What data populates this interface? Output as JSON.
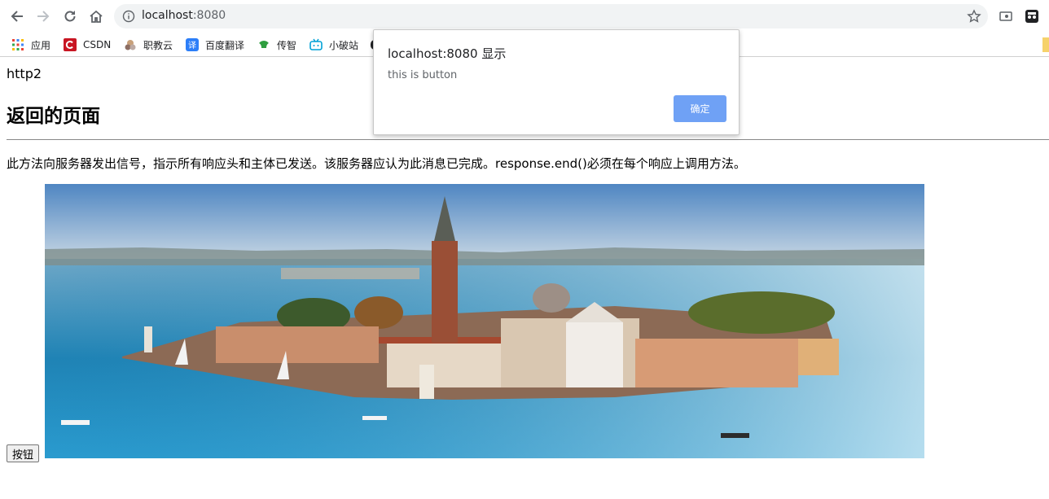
{
  "browser": {
    "url_host": "localhost",
    "url_port": ":8080",
    "bookmarks": [
      "应用",
      "CSDN",
      "职教云",
      "百度翻译",
      "传智",
      "小破站"
    ]
  },
  "page": {
    "label": "http2",
    "title": "返回的页面",
    "description": "此方法向服务器发出信号，指示所有响应头和主体已发送。该服务器应认为此消息已完成。response.end()必须在每个响应上调用方法。",
    "button_label": "按钮"
  },
  "dialog": {
    "title": "localhost:8080 显示",
    "message": "this is button",
    "ok_label": "确定"
  },
  "colors": {
    "dialog_ok": "#6fa1f5",
    "omnibox_bg": "#f1f3f4"
  }
}
